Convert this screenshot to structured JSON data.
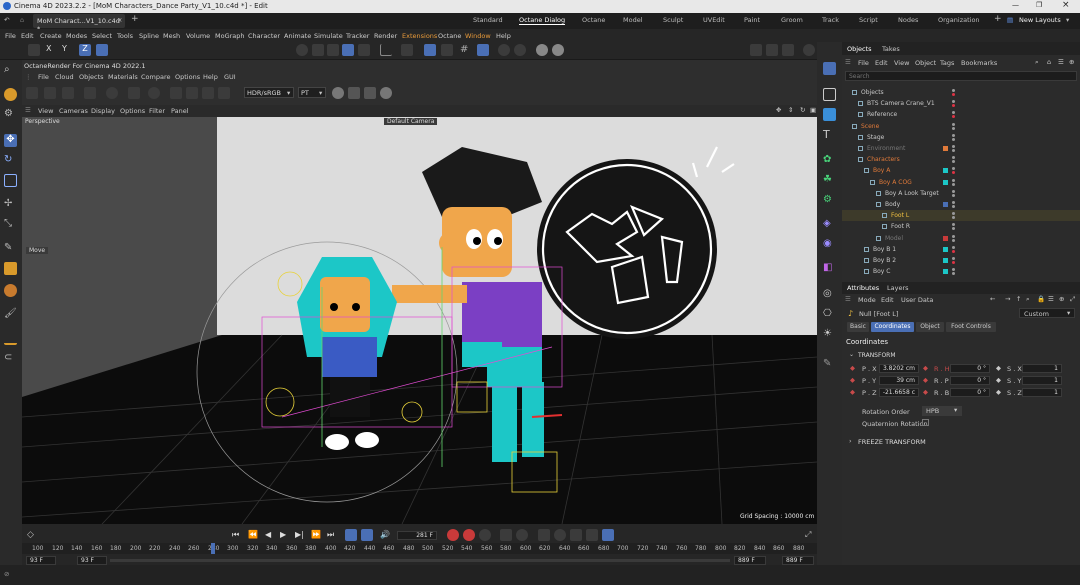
{
  "window": {
    "title": "Cinema 4D 2023.2.2 - [MoM Characters_Dance Party_V1_10.c4d *] - Edit"
  },
  "doc_tab": "MoM Charact...V1_10.c4d *",
  "layouts": [
    "Standard",
    "Octane Dialog",
    "Octane",
    "Model",
    "Sculpt",
    "UVEdit",
    "Paint",
    "Groom",
    "Track",
    "Script",
    "Nodes",
    "Organization"
  ],
  "new_layouts": "New Layouts",
  "menu": [
    "File",
    "Edit",
    "Create",
    "Modes",
    "Select",
    "Tools",
    "Spline",
    "Mesh",
    "Volume",
    "MoGraph",
    "Character",
    "Animate",
    "Simulate",
    "Tracker",
    "Render",
    "Extensions",
    "Octane",
    "Window",
    "Help"
  ],
  "octane": {
    "title": "OctaneRender For Cinema 4D 2022.1",
    "menu": [
      "File",
      "Cloud",
      "Objects",
      "Materials",
      "Compare",
      "Options",
      "Help",
      "GUI"
    ],
    "color_mode": "HDR/sRGB",
    "kernel": "PT"
  },
  "viewport": {
    "menu": [
      "View",
      "Cameras",
      "Display",
      "Options",
      "Filter",
      "Panel"
    ],
    "projection": "Perspective",
    "camera": "Default Camera",
    "grid_spacing": "Grid Spacing : 10000 cm",
    "move_label": "Move"
  },
  "objects_panel": {
    "tabs": [
      "Objects",
      "Takes"
    ],
    "menu": [
      "File",
      "Edit",
      "View",
      "Object",
      "Tags",
      "Bookmarks"
    ],
    "search_placeholder": "Search",
    "items": [
      {
        "name": "Objects",
        "color": "#c8c8c8"
      },
      {
        "name": "BTS Camera Crane_V1",
        "color": "#c8c8c8"
      },
      {
        "name": "Reference",
        "color": "#c8c8c8"
      },
      {
        "name": "Scene",
        "color": "#e07a3a"
      },
      {
        "name": "Stage",
        "color": "#c8c8c8"
      },
      {
        "name": "Environment",
        "color": "#777777"
      },
      {
        "name": "Characters",
        "color": "#e07a3a"
      },
      {
        "name": "Boy A",
        "color": "#e07a3a"
      },
      {
        "name": "Boy A COG",
        "color": "#e07a3a"
      },
      {
        "name": "Boy A Look Target",
        "color": "#c8c8c8"
      },
      {
        "name": "Body",
        "color": "#c8c8c8"
      },
      {
        "name": "Foot L",
        "color": "#f0c040"
      },
      {
        "name": "Foot R",
        "color": "#c8c8c8"
      },
      {
        "name": "Model",
        "color": "#777777"
      },
      {
        "name": "Boy B 1",
        "color": "#c8c8c8"
      },
      {
        "name": "Boy B 2",
        "color": "#c8c8c8"
      },
      {
        "name": "Boy C",
        "color": "#c8c8c8"
      }
    ]
  },
  "attributes": {
    "tabs": [
      "Attributes",
      "Layers"
    ],
    "menu": [
      "Mode",
      "Edit",
      "User Data"
    ],
    "object": "Null [Foot L]",
    "preset": "Custom",
    "subtabs": [
      "Basic",
      "Coordinates",
      "Object",
      "Foot Controls"
    ],
    "section": "Coordinates",
    "transform": "TRANSFORM",
    "rows": [
      {
        "p_label": "P . X",
        "p": "3.8202 cm",
        "r_label": "R . H",
        "r": "0 °",
        "s_label": "S . X",
        "s": "1"
      },
      {
        "p_label": "P . Y",
        "p": "39 cm",
        "r_label": "R . P",
        "r": "0 °",
        "s_label": "S . Y",
        "s": "1"
      },
      {
        "p_label": "P . Z",
        "p": "-21.6658 c",
        "r_label": "R . B",
        "r": "0 °",
        "s_label": "S . Z",
        "s": "1"
      }
    ],
    "rotation_order_label": "Rotation Order",
    "rotation_order": "HPB",
    "quaternion_label": "Quaternion Rotation",
    "freeze": "FREEZE TRANSFORM"
  },
  "timeline": {
    "current_frame": "281 F",
    "ticks": [
      "100",
      "120",
      "140",
      "160",
      "180",
      "200",
      "220",
      "240",
      "260",
      "280",
      "300",
      "320",
      "340",
      "360",
      "380",
      "400",
      "420",
      "440",
      "460",
      "480",
      "500",
      "520",
      "540",
      "560",
      "580",
      "600",
      "620",
      "640",
      "660",
      "680",
      "700",
      "720",
      "740",
      "760",
      "780",
      "800",
      "820",
      "840",
      "860",
      "880"
    ],
    "start_a": "93 F",
    "start_b": "93 F",
    "end_a": "889 F",
    "end_b": "889 F"
  },
  "colors": {
    "accent": "#4a6fb5",
    "orange": "#e07a3a",
    "teal": "#1cc7c7",
    "purple": "#7b3fc4"
  }
}
